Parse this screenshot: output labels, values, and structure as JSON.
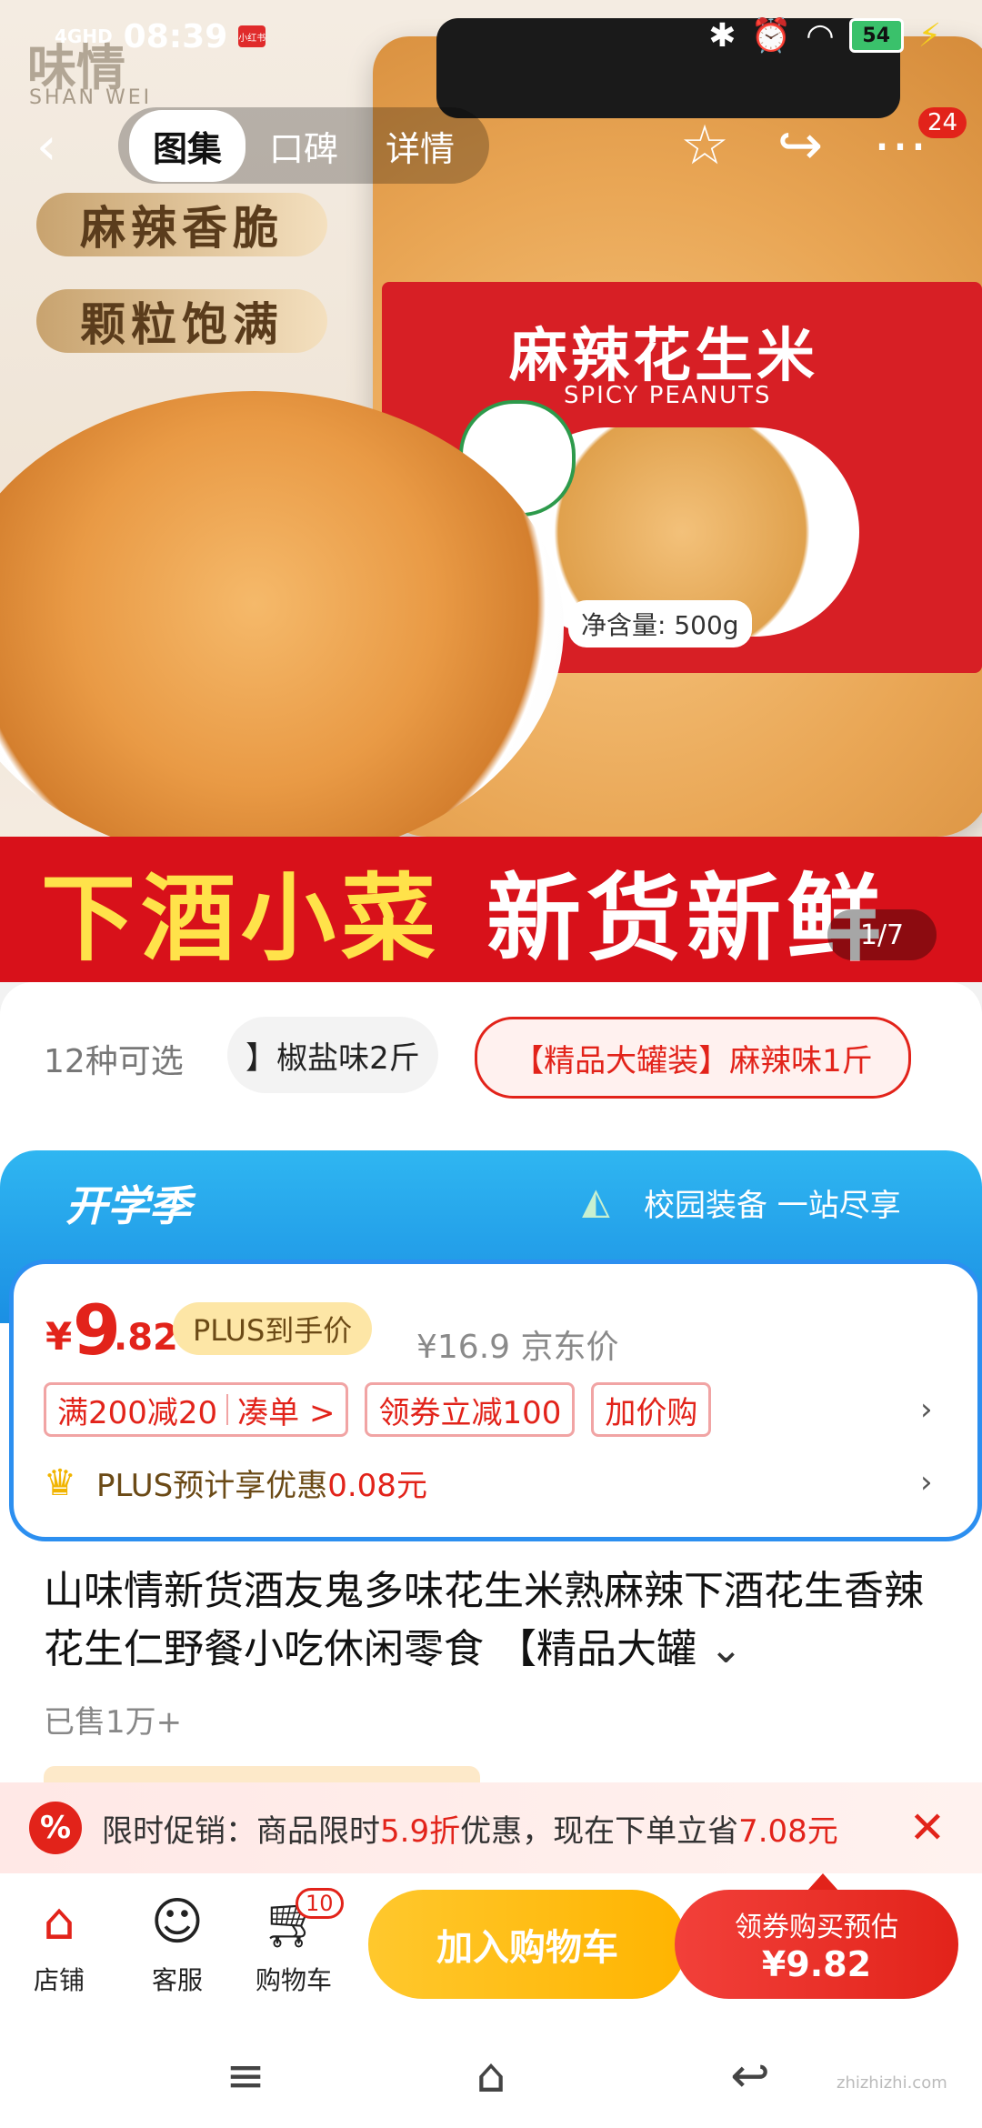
{
  "status_bar": {
    "network": "4GHD",
    "time": "08:39",
    "app_badge": "小红书",
    "battery": "54"
  },
  "nav": {
    "tabs": [
      "图集",
      "口碑",
      "详情"
    ],
    "more_badge": "24"
  },
  "hero": {
    "brand": "味情",
    "brand_sub": "SHAN WEI",
    "tags": [
      "麻辣香脆",
      "颗粒饱满"
    ],
    "label_title": "麻辣花生米",
    "label_sub": "SPICY PEANUTS",
    "net_weight": "净含量: 500g",
    "banner_left": "下酒小菜",
    "banner_right": "新货新鲜",
    "counter": "1/7"
  },
  "variants": {
    "count_label": "12种可选",
    "chips": [
      "】椒盐味2斤",
      "【精品大罐装】麻辣味1斤"
    ]
  },
  "promo": {
    "title": "开学季",
    "tag": "校园装备 一站尽享",
    "currency": "¥",
    "price_int": "9",
    "price_dec": ".82",
    "plus_price_label": "PLUS到手价",
    "jd_price": "¥16.9 京东价",
    "coupon_1a": "满200减20",
    "coupon_1b": "凑单 >",
    "coupon_2": "领券立减100",
    "coupon_3": "加价购",
    "plus_row_text": "PLUS预计享优惠",
    "plus_row_amount": "0.08元"
  },
  "product": {
    "title": "山味情新货酒友鬼多味花生米熟麻辣下酒花生香辣花生仁野餐小吃休闲零食 【精品大罐",
    "sold": "已售1万+"
  },
  "flash": {
    "icon": "%",
    "text_a": "限时促销：商品限时",
    "text_b": "5.9折",
    "text_c": "优惠，现在下单立省",
    "text_d": "7.08元"
  },
  "actions": {
    "store": "店铺",
    "service": "客服",
    "cart": "购物车",
    "cart_badge": "10",
    "add_to_cart": "加入购物车",
    "buy_line1": "领券购买预估",
    "buy_line2": "¥9.82"
  },
  "watermark": "zhizhizhi.com"
}
